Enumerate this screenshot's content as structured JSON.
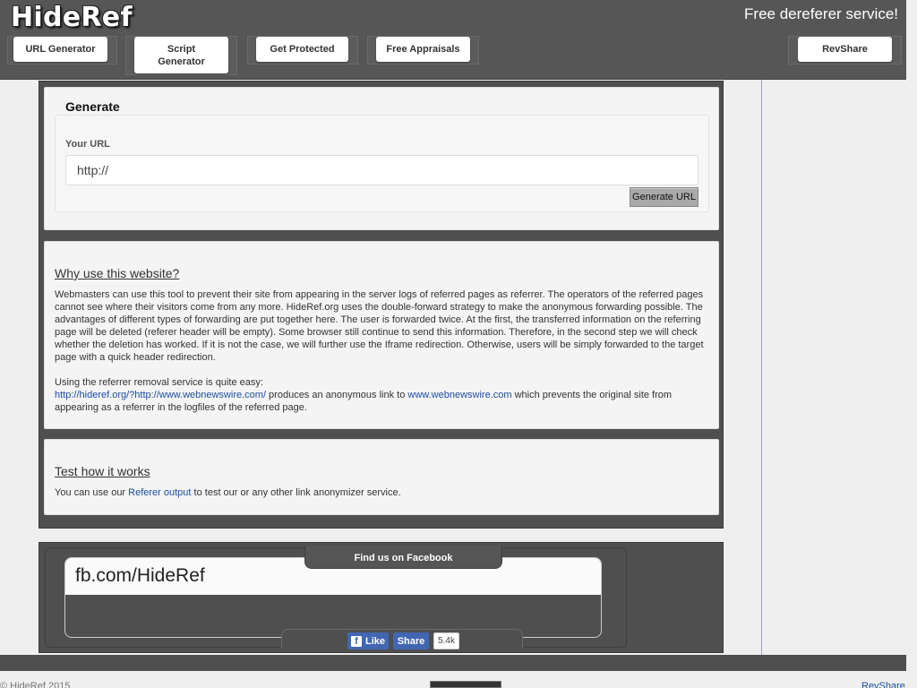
{
  "header": {
    "logo": "HideRef",
    "tagline": "Free dereferer service!"
  },
  "nav": {
    "url_generator": "URL Generator",
    "script_generator": "Script Generator",
    "get_protected": "Get Protected",
    "free_appraisals": "Free Appraisals",
    "revshare": "RevShare"
  },
  "generate": {
    "title": "Generate",
    "url_label": "Your URL",
    "url_value": "http://",
    "button": "Generate URL"
  },
  "why": {
    "title": "Why use this website?",
    "body": "Webmasters can use this tool to prevent their site from appearing in the server logs of referred pages as referrer. The operators of the referred pages cannot see where their visitors come from any more. HideRef.org uses the double-forward strategy to make the anonymous forwarding possible. The advantages of different types of forwarding are put together here. The user is forwarded twice. At the first, the transferred information on the referring page will be deleted (referer header will be empty). Some browser still continue to send this information. Therefore, in the second step we will check whether the deletion has worked. If it is not the case, we will further use the Iframe redirection. Otherwise, users will be simply forwarded to the target page with a quick header redirection.",
    "usage_intro": "Using the referrer removal service is quite easy:",
    "example_link": "http://hideref.org/?http://www.webnewswire.com/",
    "example_mid": " produces an anonymous link to ",
    "target_link": "www.webnewswire.com",
    "example_end": " which prevents the original site from appearing as a referrer in the logfiles of the referred page."
  },
  "test": {
    "title": "Test how it works",
    "pre": "You can use our ",
    "link": "Referer output",
    "post": " to test our or any other link anonymizer service."
  },
  "facebook": {
    "tab_label": "Find us on Facebook",
    "handle": "fb.com/HideRef",
    "like": "Like",
    "share": "Share",
    "count": "5.4k"
  },
  "footer": {
    "copyright": "© HideRef 2015",
    "revshare": "RevShare"
  },
  "colors": {
    "header_bg": "#565656",
    "panel_bg": "#4f4f4f",
    "link": "#1c4fa0",
    "facebook": "#4267b2"
  }
}
